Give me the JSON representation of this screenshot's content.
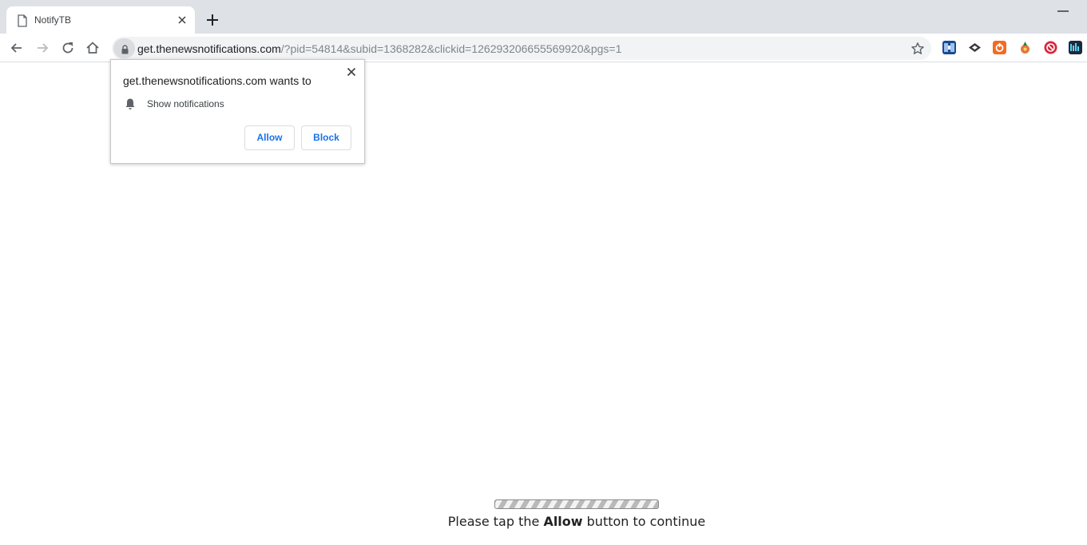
{
  "tab": {
    "title": "NotifyTB",
    "icon": "page-icon"
  },
  "address_bar": {
    "host": "get.thenewsnotifications.com",
    "path": "/?pid=54814&subid=1368282&clickid=126293206655569920&pgs=1"
  },
  "extensions": [
    "ext-icon-1",
    "ext-icon-2",
    "ext-icon-3",
    "ext-icon-4",
    "ext-icon-5",
    "ext-icon-6"
  ],
  "permission_popup": {
    "title": "get.thenewsnotifications.com wants to",
    "permission": "Show notifications",
    "allow_label": "Allow",
    "block_label": "Block"
  },
  "page": {
    "message_before": "Please tap the ",
    "message_bold": "Allow",
    "message_after": " button to continue"
  },
  "colors": {
    "accent": "#1a73e8",
    "tabstrip": "#dee1e6",
    "omnibox": "#f1f3f4"
  }
}
